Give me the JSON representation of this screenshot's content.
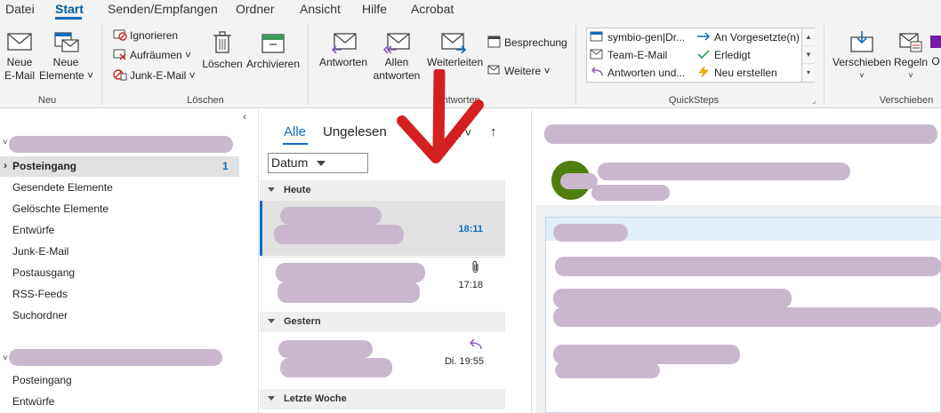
{
  "menu": {
    "tabs": [
      "Datei",
      "Start",
      "Senden/Empfangen",
      "Ordner",
      "Ansicht",
      "Hilfe",
      "Acrobat"
    ],
    "active": "Start"
  },
  "ribbon": {
    "neu": {
      "group_label": "Neu",
      "new_email": "Neue\nE-Mail",
      "new_email_l1": "Neue",
      "new_email_l2": "E-Mail",
      "new_items_l1": "Neue",
      "new_items_l2": "Elemente ˅"
    },
    "loeschen": {
      "group_label": "Löschen",
      "ignore": "Ignorieren",
      "cleanup": "Aufräumen ˅",
      "junk": "Junk-E-Mail ˅",
      "delete": "Löschen",
      "archive": "Archivieren"
    },
    "antworten": {
      "group_label": "Antworten",
      "reply": "Antworten",
      "reply_all_l1": "Allen",
      "reply_all_l2": "antworten",
      "forward": "Weiterleiten",
      "meeting": "Besprechung",
      "more": "Weitere ˅"
    },
    "quicksteps": {
      "group_label": "QuickSteps",
      "items": [
        "symbio-gen|Dr...",
        "Team-E-Mail",
        "Antworten und...",
        "An Vorgesetzte(n)",
        "Erledigt",
        "Neu erstellen"
      ]
    },
    "verschieben": {
      "group_label": "Verschieben",
      "move": "Verschieben",
      "rules": "Regeln",
      "onenote_partial": "O"
    }
  },
  "folders": {
    "account1": [
      {
        "label": "Posteingang",
        "selected": true,
        "count": "1"
      },
      {
        "label": "Gesendete Elemente"
      },
      {
        "label": "Gelöschte Elemente"
      },
      {
        "label": "Entwürfe"
      },
      {
        "label": "Junk-E-Mail"
      },
      {
        "label": "Postausgang"
      },
      {
        "label": "RSS-Feeds"
      },
      {
        "label": "Suchordner"
      }
    ],
    "account2": [
      {
        "label": "Posteingang"
      },
      {
        "label": "Entwürfe"
      }
    ]
  },
  "message_list": {
    "filter_all": "Alle",
    "filter_unread": "Ungelesen",
    "sort_partial": "m ˅",
    "sort_direction": "↑",
    "sort_by": "Datum",
    "groups": {
      "today": "Heute",
      "yesterday": "Gestern",
      "last_week": "Letzte Woche"
    },
    "messages": [
      {
        "time": "18:11",
        "unread": true,
        "selected": true
      },
      {
        "time": "17:18",
        "attachment": true
      },
      {
        "time": "Di. 19:55",
        "replied": true
      }
    ]
  },
  "colors": {
    "accent": "#0f6cbd",
    "avatar": "#4f7d0e",
    "annotation": "#d42020",
    "redaction": "#c9b8cd"
  }
}
